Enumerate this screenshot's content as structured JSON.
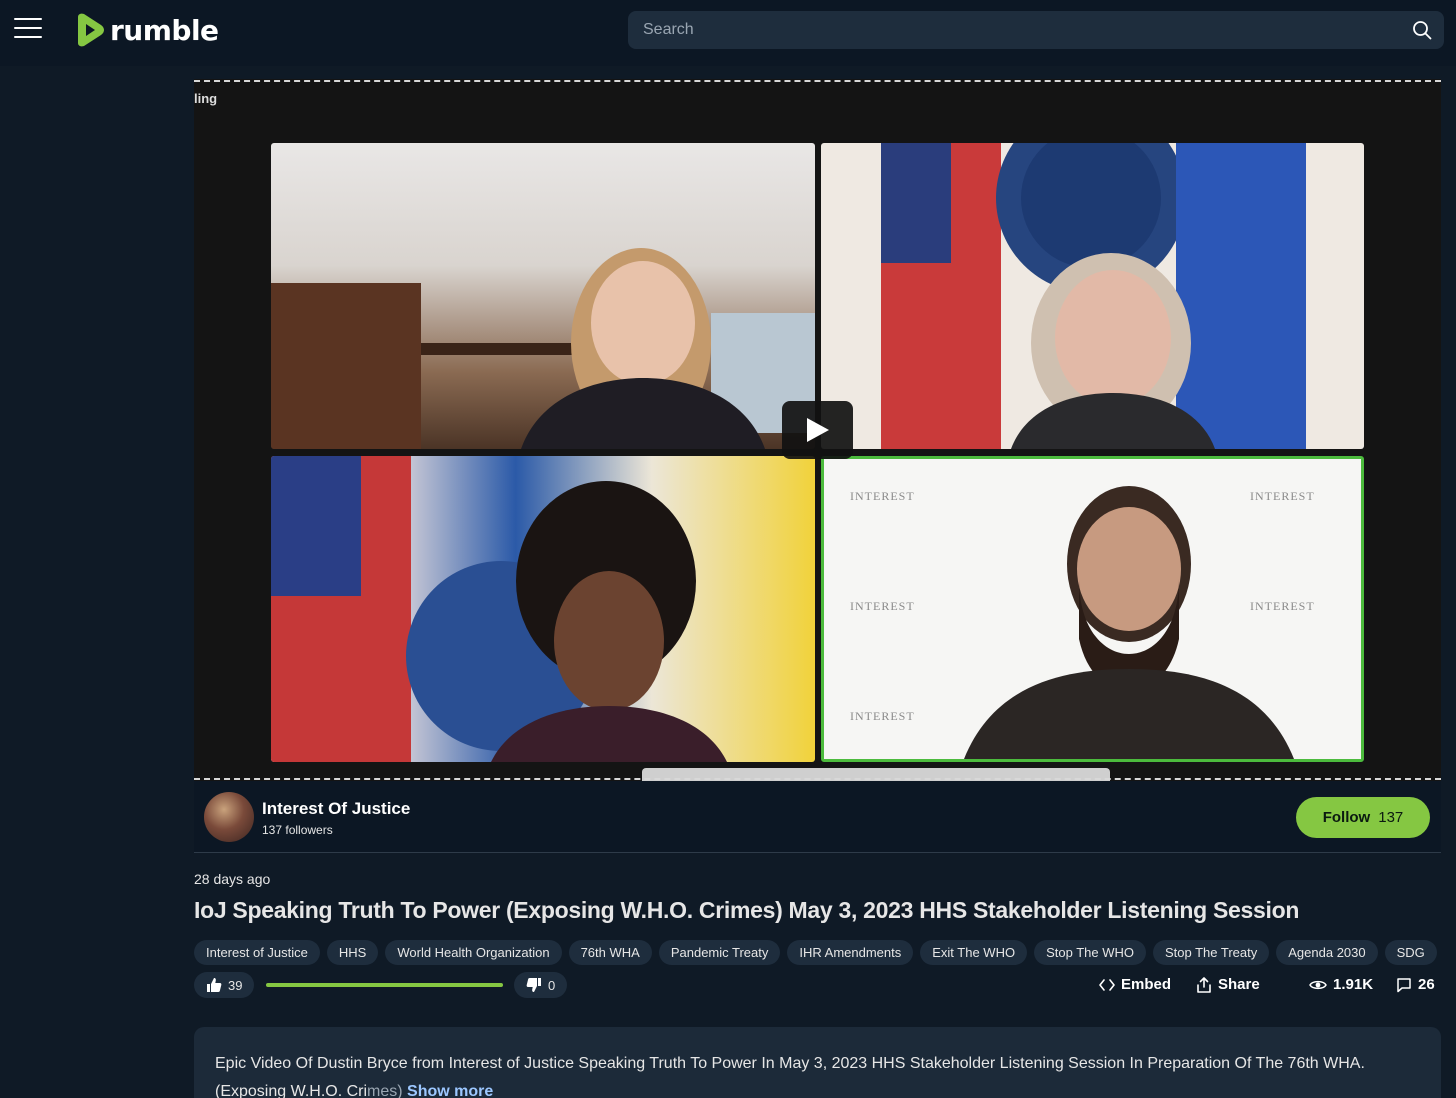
{
  "header": {
    "logo_text": "rumble",
    "search_placeholder": "Search"
  },
  "player": {
    "corner_text": "ling",
    "watermark": "INTEREST"
  },
  "channel": {
    "name": "Interest Of Justice",
    "followers": "137 followers",
    "follow_label": "Follow",
    "follow_count": "137"
  },
  "video": {
    "posted": "28 days ago",
    "title": "IoJ Speaking Truth To Power (Exposing W.H.O. Crimes) May 3, 2023 HHS Stakeholder Listening Session",
    "tags": [
      "Interest of Justice",
      "HHS",
      "World Health Organization",
      "76th WHA",
      "Pandemic Treaty",
      "IHR Amendments",
      "Exit The WHO",
      "Stop The WHO",
      "Stop The Treaty",
      "Agenda 2030",
      "SDG"
    ],
    "likes": "39",
    "dislikes": "0",
    "like_ratio": 1.0,
    "embed_label": "Embed",
    "share_label": "Share",
    "views": "1.91K",
    "comments": "26"
  },
  "description": {
    "line1": "Epic Video Of Dustin Bryce from Interest of Justice Speaking Truth To Power In May 3, 2023 HHS Stakeholder Listening Session In Preparation Of The 76th WHA.",
    "line2_start": "(Exposing W.H.O. Cri",
    "line2_fade": "mes)",
    "show_more": "Show more"
  },
  "colors": {
    "accent": "#85c742",
    "background": "#0f1a26",
    "header": "#0c1724",
    "pill": "#1e2d3d"
  }
}
